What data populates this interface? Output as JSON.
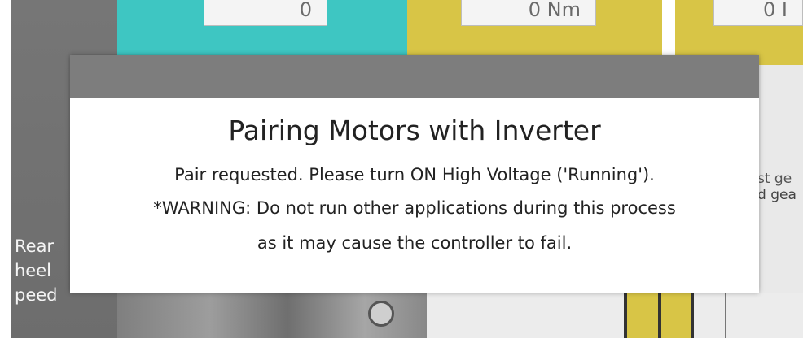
{
  "background": {
    "field_a_value": "0",
    "field_b_value": "0 Nm",
    "field_c_value": "0 I",
    "right_text_line1": "st ge",
    "right_text_line2": "d gea",
    "left_label_lines": [
      "Rear",
      "heel",
      "peed"
    ]
  },
  "dialog": {
    "title": "Pairing Motors with Inverter",
    "message": "Pair requested. Please turn ON High Voltage ('Running').",
    "warning_line1": "*WARNING: Do not run other applications during this process",
    "warning_line2": "as it may cause the controller to fail."
  },
  "colors": {
    "teal_panel": "#3ec6c2",
    "yellow_panel": "#d8c546",
    "dialog_header": "#7d7d7d",
    "dialog_body": "#ffffff"
  }
}
